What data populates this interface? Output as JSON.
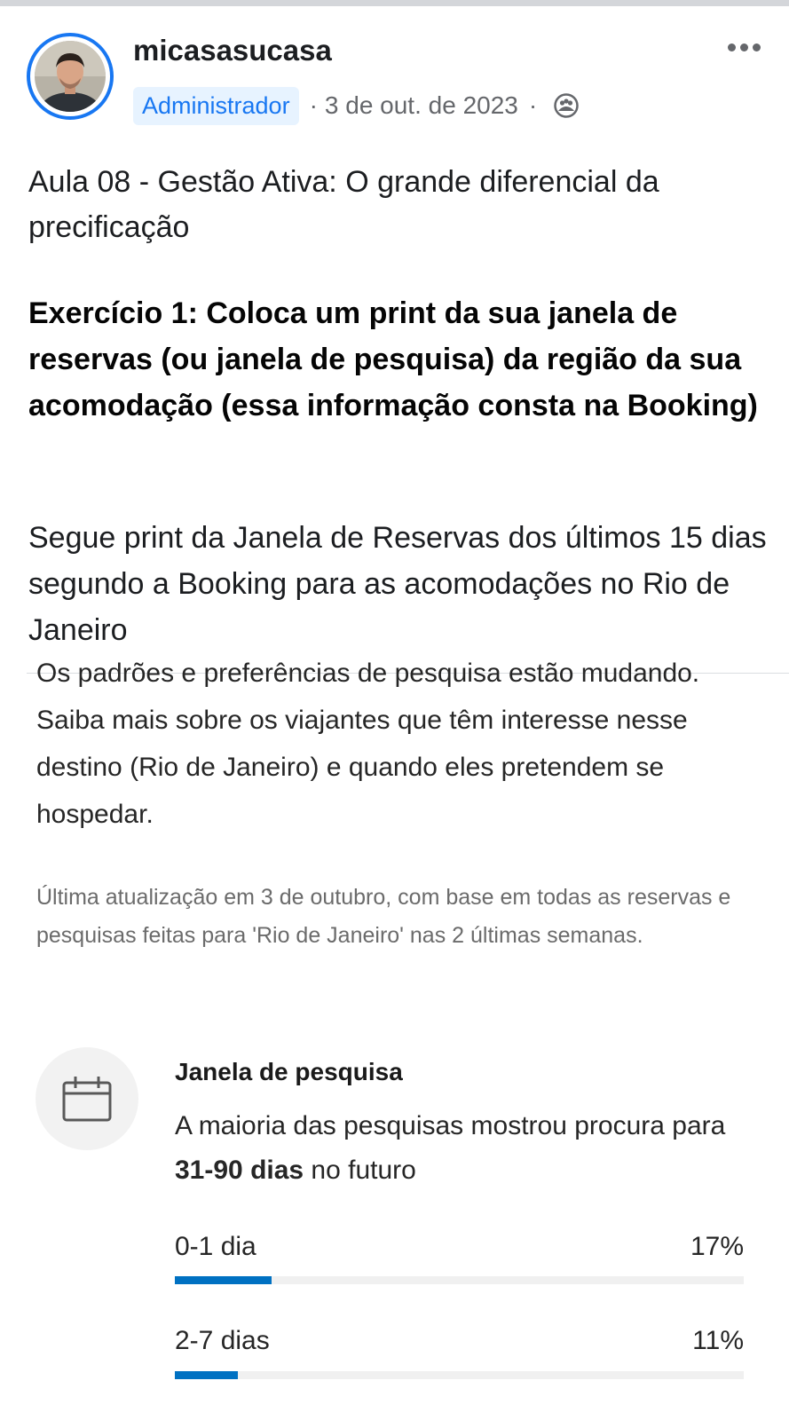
{
  "post": {
    "author": "micasasucasa",
    "role_badge": "Administrador",
    "separator_1": "·",
    "date": "3 de out. de 2023",
    "separator_2": "·",
    "title": "Aula 08 - Gestão Ativa: O grande diferencial da precificação",
    "exercise": "Exercício 1: Coloca um print da sua janela de reservas (ou janela de pesquisa) da região da sua acomodação (essa informação consta na Booking)",
    "reply": "Segue print da Janela de Reservas dos últimos 15 dias segundo a Booking para as acomodações no Rio de Janeiro"
  },
  "screenshot": {
    "intro": "Os padrões e preferências de pesquisa estão mudando. Saiba mais sobre os viajantes que têm interesse nesse destino (Rio de Janeiro) e quando eles pretendem se hospedar.",
    "update_note": "Última atualização em 3 de outubro, com base em todas as reservas e pesquisas feitas para 'Rio de Janeiro' nas 2 últimas semanas.",
    "section": {
      "icon": "calendar-icon",
      "title": "Janela de pesquisa",
      "desc_prefix": "A maioria das pesquisas mostrou procura para ",
      "desc_bold": "31-90 dias",
      "desc_suffix": " no futuro"
    },
    "rows": [
      {
        "label": "0-1 dia",
        "percent_label": "17%",
        "value": 17
      },
      {
        "label": "2-7 dias",
        "percent_label": "11%",
        "value": 11
      }
    ]
  },
  "colors": {
    "accent": "#1877f2",
    "badge_bg": "#e7f3ff",
    "bar": "#0071c2",
    "bar_track": "#f0f0f0"
  },
  "icons": {
    "more": "more-horizontal-icon",
    "audience": "group-audience-icon",
    "calendar": "calendar-icon"
  }
}
